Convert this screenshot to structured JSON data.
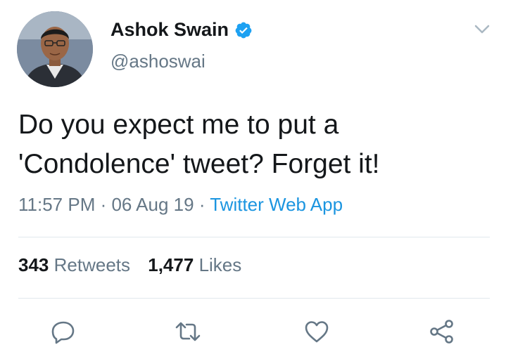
{
  "author": {
    "name": "Ashok Swain",
    "handle": "@ashoswai",
    "verified": true
  },
  "tweet": {
    "text_line1": "Do you expect me to put a",
    "text_line2": "'Condolence' tweet? Forget it!",
    "time": "11:57 PM",
    "separator": " · ",
    "date": "06 Aug 19",
    "source": "Twitter Web App"
  },
  "stats": {
    "retweets_count": "343",
    "retweets_label": "Retweets",
    "likes_count": "1,477",
    "likes_label": "Likes"
  },
  "actions": [
    {
      "icon": "reply-icon"
    },
    {
      "icon": "retweet-icon"
    },
    {
      "icon": "like-icon"
    },
    {
      "icon": "share-icon"
    }
  ],
  "colors": {
    "text": "#14171a",
    "secondary": "#657786",
    "link": "#1b95e0",
    "verified": "#1da1f2",
    "divider": "#e1e8ed"
  }
}
